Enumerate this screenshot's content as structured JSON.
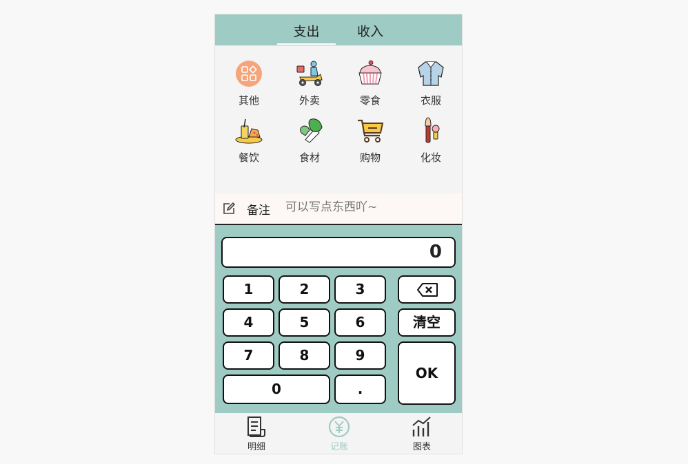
{
  "tabs": [
    {
      "label": "支出",
      "active": true
    },
    {
      "label": "收入",
      "active": false
    }
  ],
  "categories": [
    {
      "label": "其他",
      "icon": "other-icon"
    },
    {
      "label": "外卖",
      "icon": "delivery-scooter-icon"
    },
    {
      "label": "零食",
      "icon": "cupcake-icon"
    },
    {
      "label": "衣服",
      "icon": "shirt-icon"
    },
    {
      "label": "餐饮",
      "icon": "meal-icon"
    },
    {
      "label": "食材",
      "icon": "vegetable-icon"
    },
    {
      "label": "购物",
      "icon": "shopping-cart-icon"
    },
    {
      "label": "化妆",
      "icon": "makeup-brush-icon"
    }
  ],
  "memo": {
    "label": "备注",
    "placeholder": "可以写点东西吖~"
  },
  "keypad": {
    "display": "0",
    "keys": {
      "k1": "1",
      "k2": "2",
      "k3": "3",
      "k4": "4",
      "k5": "5",
      "k6": "6",
      "k7": "7",
      "k8": "8",
      "k9": "9",
      "k0": "0",
      "dot": "."
    },
    "clear": "清空",
    "ok": "OK"
  },
  "bottom_nav": [
    {
      "label": "明细",
      "icon": "document-list-icon",
      "active": false
    },
    {
      "label": "记账",
      "icon": "yuan-circle-icon",
      "active": true
    },
    {
      "label": "图表",
      "icon": "bar-chart-icon",
      "active": false
    }
  ],
  "colors": {
    "accent": "#9ecbc3",
    "background": "#f4f4f4"
  }
}
